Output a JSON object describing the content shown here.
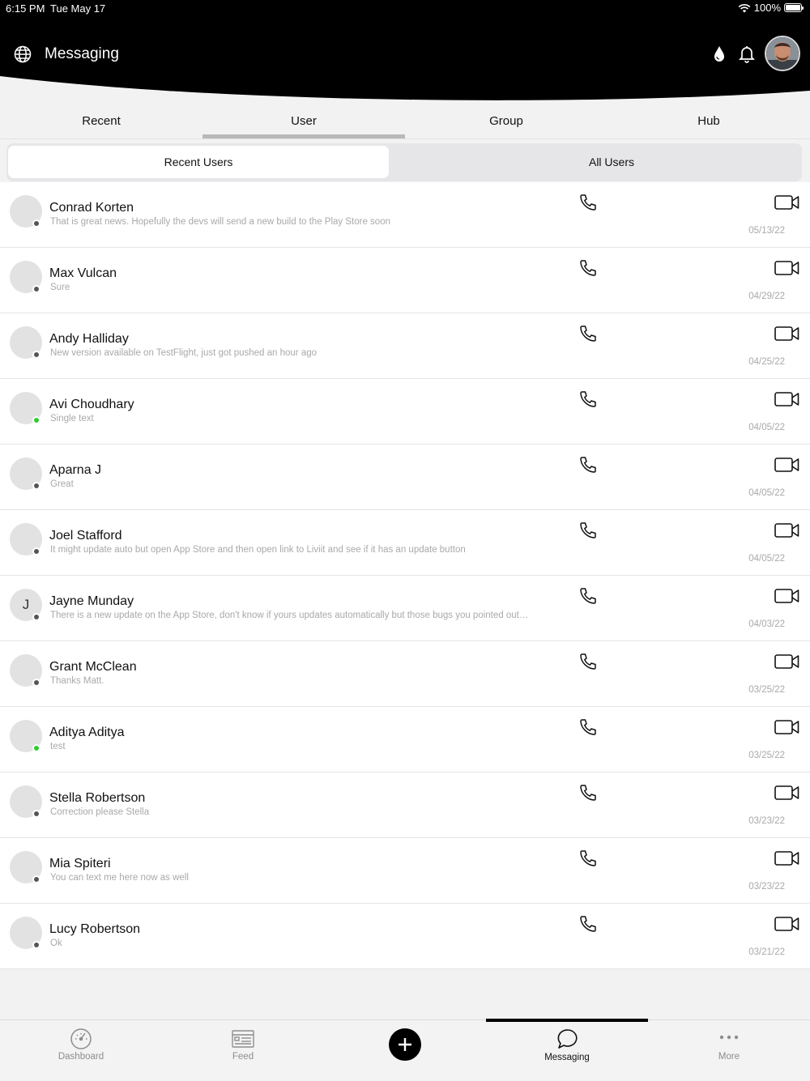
{
  "status_bar": {
    "time": "6:15 PM",
    "date": "Tue May 17",
    "battery": "100%"
  },
  "header": {
    "title": "Messaging"
  },
  "tabs": [
    {
      "label": "Recent"
    },
    {
      "label": "User"
    },
    {
      "label": "Group"
    },
    {
      "label": "Hub"
    }
  ],
  "segment": {
    "left": "Recent Users",
    "right": "All Users"
  },
  "contacts": [
    {
      "initial": "",
      "name": "Conrad Korten",
      "message": "That is great news.  Hopefully the devs will send a new build to the Play Store soon",
      "date": "05/13/22",
      "status": "offline"
    },
    {
      "initial": "",
      "name": "Max Vulcan",
      "message": "Sure",
      "date": "04/29/22",
      "status": "offline"
    },
    {
      "initial": "",
      "name": "Andy Halliday",
      "message": "New version available on TestFlight, just got pushed an hour ago",
      "date": "04/25/22",
      "status": "offline"
    },
    {
      "initial": "",
      "name": "Avi Choudhary",
      "message": "Single text",
      "date": "04/05/22",
      "status": "online"
    },
    {
      "initial": "",
      "name": "Aparna J",
      "message": "Great",
      "date": "04/05/22",
      "status": "offline"
    },
    {
      "initial": "",
      "name": "Joel Stafford",
      "message": "It might update auto but open App Store and then open link to Liviit and see if it has an update button",
      "date": "04/05/22",
      "status": "offline"
    },
    {
      "initial": "J",
      "name": "Jayne Munday",
      "message": "There is a new update on the App Store, don't know if yours updates automatically but those bugs you pointed out…",
      "date": "04/03/22",
      "status": "offline"
    },
    {
      "initial": "",
      "name": "Grant McClean",
      "message": "Thanks Matt.",
      "date": "03/25/22",
      "status": "offline"
    },
    {
      "initial": "",
      "name": "Aditya Aditya",
      "message": "test",
      "date": "03/25/22",
      "status": "online"
    },
    {
      "initial": "",
      "name": "Stella Robertson",
      "message": "Correction please Stella",
      "date": "03/23/22",
      "status": "offline"
    },
    {
      "initial": "",
      "name": "Mia Spiteri",
      "message": "You can text me here now as well",
      "date": "03/23/22",
      "status": "offline"
    },
    {
      "initial": "",
      "name": "Lucy Robertson",
      "message": "Ok",
      "date": "03/21/22",
      "status": "offline"
    }
  ],
  "bottom_nav": {
    "dashboard": "Dashboard",
    "feed": "Feed",
    "messaging": "Messaging",
    "more": "More"
  },
  "colors": {
    "online": "#2ecc2e",
    "offline": "#555555",
    "header_bg": "#000000"
  }
}
